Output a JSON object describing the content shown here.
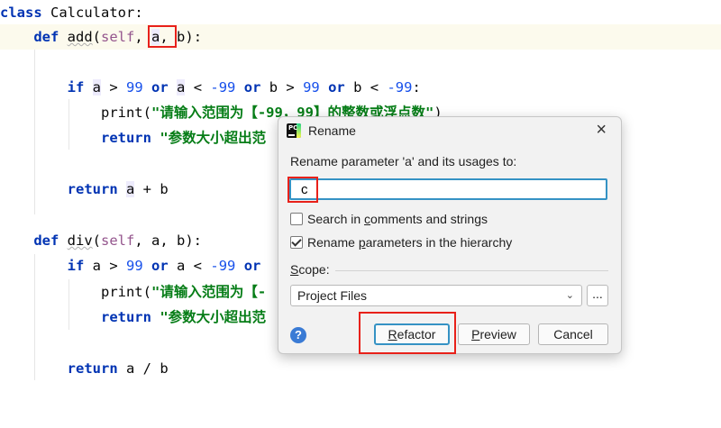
{
  "code": {
    "line1": {
      "kw": "class",
      "rest": " Calculator:"
    },
    "line2": {
      "kw": "def",
      "fname": "add",
      "open": "(",
      "self": "self",
      "comma1": ", ",
      "p1": "a",
      "comma2": ", ",
      "p2": "b",
      "close": "):"
    },
    "line4": {
      "kw_if": "if",
      "a1": "a",
      "t1": " > ",
      "n1": "99",
      "or1": "or",
      "a2": "a",
      "t2": " < ",
      "n2": "-99",
      "or2": "or",
      "t3": " b > ",
      "n3": "99",
      "or3": "or",
      "t4": " b < ",
      "n4": "-99",
      "t5": ":"
    },
    "line5": {
      "fn": "print(",
      "str": "\"请输入范围为【-99，99】的整数或浮点数\"",
      "end": ")"
    },
    "line6": {
      "kw": "return",
      "str": "\"参数大小超出范"
    },
    "line8": {
      "kw": "return",
      "a": "a",
      "rest": " + b"
    },
    "line10": {
      "kw": "def",
      "fname": "div",
      "open": "(",
      "self": "self",
      "rest": ", a, b):"
    },
    "line11": {
      "kw_if": "if",
      "t1": " a > ",
      "n1": "99",
      "or1": "or",
      "t2": " a < ",
      "n2": "-99",
      "or2": "or"
    },
    "line12": {
      "fn": "print(",
      "str": "\"请输入范围为【-"
    },
    "line13": {
      "kw": "return",
      "str": "\"参数大小超出范"
    },
    "line15": {
      "kw": "return",
      "rest": " a / b"
    }
  },
  "dialog": {
    "title": "Rename",
    "prompt": "Rename parameter 'a' and its usages to:",
    "new_name": "c",
    "search_comments": {
      "pre": "Search in ",
      "u": "c",
      "post": "omments and strings",
      "checked": false
    },
    "rename_hierarchy": {
      "pre": "Rename ",
      "u": "p",
      "post": "arameters in the hierarchy",
      "checked": true
    },
    "scope_label": {
      "u": "S",
      "rest": "cope:"
    },
    "scope_value": "Project Files",
    "dots": "...",
    "help": "?",
    "refactor": {
      "u": "R",
      "rest": "efactor"
    },
    "preview": {
      "u": "P",
      "rest": "review"
    },
    "cancel": "Cancel"
  }
}
